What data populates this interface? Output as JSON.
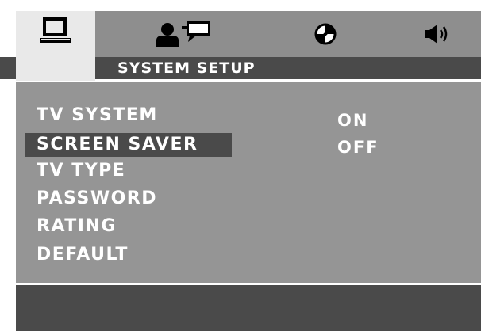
{
  "tabs": [
    {
      "icon": "tv-monitor-icon",
      "name": "system"
    },
    {
      "icon": "language-person-speech-icon",
      "name": "language"
    },
    {
      "icon": "video-icon",
      "name": "video"
    },
    {
      "icon": "speaker-icon",
      "name": "audio"
    }
  ],
  "header": {
    "title": "SYSTEM SETUP"
  },
  "menu": {
    "items": [
      "TV SYSTEM",
      "SCREEN SAVER",
      "TV TYPE",
      "PASSWORD",
      "RATING",
      "DEFAULT"
    ],
    "selected": "SCREEN SAVER"
  },
  "options": [
    "ON",
    "OFF"
  ],
  "help": {
    "text": ""
  },
  "colors": {
    "dark": "#4a4a4a",
    "panel": "#959595",
    "tab_bar": "#8e8e8e",
    "active_tab": "#e9e9e9",
    "text": "#ffffff"
  }
}
